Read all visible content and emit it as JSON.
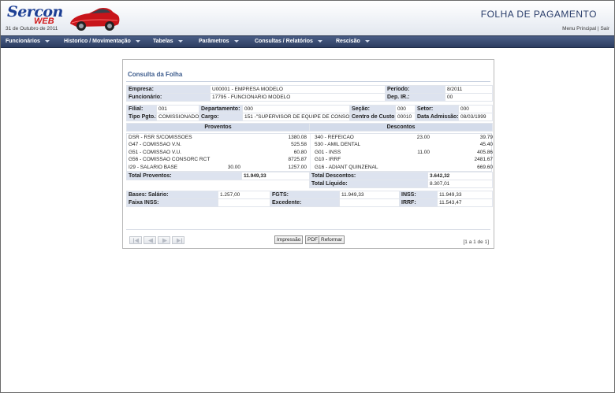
{
  "header": {
    "logo_main": "Sercon",
    "logo_sub": "WEB",
    "app_title": "FOLHA DE PAGAMENTO",
    "date": "31 de Outubro de 2011",
    "menu_principal": "Menu Principal",
    "separator": "|",
    "sair": "Sair"
  },
  "nav": {
    "items": [
      "Funcionários",
      "Historico / Movimentação",
      "Tabelas",
      "Parâmetros",
      "Consultas / Relatórios",
      "Rescisão"
    ]
  },
  "panel": {
    "title": "Consulta da Folha"
  },
  "info": {
    "empresa_label": "Empresa:",
    "empresa_value": "U00001 - EMPRESA MODELO",
    "periodo_label": "Período:",
    "periodo_value": "8/2011",
    "funcionario_label": "Funcionário:",
    "funcionario_value": "17795 - FUNCIONARIO MODELO",
    "depir_label": "Dep. IR.:",
    "depir_value": "00",
    "filial_label": "Filial:",
    "filial_value": "001",
    "departamento_label": "Departamento:",
    "departamento_value": "000",
    "secao_label": "Seção:",
    "secao_value": "000",
    "setor_label": "Setor:",
    "setor_value": "000",
    "tipopgto_label": "Tipo Pgto.:",
    "tipopgto_value": "COMISSIONADO",
    "cargo_label": "Cargo:",
    "cargo_value": "151 -\"SUPERVISOR DE EQUIPE DE CONSORCIO",
    "centrocusto_label": "Centro de Custo:",
    "centrocusto_value": "00010",
    "admissao_label": "Data Admissão:",
    "admissao_value": "08/03/1999"
  },
  "proventos_header": "Proventos",
  "descontos_header": "Descontos",
  "proventos": [
    {
      "desc": "DSR - RSR S/COMISSOES",
      "ref": "",
      "valor": "1380.08"
    },
    {
      "desc": "G47 - COMISSAO V.N.",
      "ref": "",
      "valor": "525.58"
    },
    {
      "desc": "G51 - COMISSAO V.U.",
      "ref": "",
      "valor": "60.80"
    },
    {
      "desc": "G56 - COMISSAO CONSORC RCT",
      "ref": "",
      "valor": "8725.87"
    },
    {
      "desc": "I29 - SALARIO BASE",
      "ref": "30.00",
      "valor": "1257.00"
    }
  ],
  "descontos": [
    {
      "desc": "340 - REFEICAO",
      "ref": "23.00",
      "valor": "39.79"
    },
    {
      "desc": "530 - AMIL DENTAL",
      "ref": "",
      "valor": "45.40"
    },
    {
      "desc": "G01 - INSS",
      "ref": "11.00",
      "valor": "405.86"
    },
    {
      "desc": "G10 - IRRF",
      "ref": "",
      "valor": "2481.67"
    },
    {
      "desc": "G16 - ADIANT QUINZENAL",
      "ref": "",
      "valor": "669.60"
    }
  ],
  "totals": {
    "total_proventos_label": "Total Proventos:",
    "total_proventos_value": "11.949,33",
    "total_descontos_label": "Total Descontos:",
    "total_descontos_value": "3.642,32",
    "total_liquido_label": "Total Líquido:",
    "total_liquido_value": "8.307,01"
  },
  "bases": {
    "salario_label": "Bases: Salário:",
    "salario_value": "1.257,00",
    "fgts_label": "FGTS:",
    "fgts_value": "11.949,33",
    "inss_label": "INSS:",
    "inss_value": "11.949,33",
    "faixa_label": "Faixa INSS:",
    "faixa_value": "",
    "excedente_label": "Excedente:",
    "excedente_value": "",
    "irrf_label": "IRRF:",
    "irrf_value": "11.543,47"
  },
  "buttons": {
    "impressao": "Impressão",
    "pdf": "PDF",
    "reformar": "Reformar"
  },
  "pager": {
    "info": "[1 a 1 de 1]"
  }
}
